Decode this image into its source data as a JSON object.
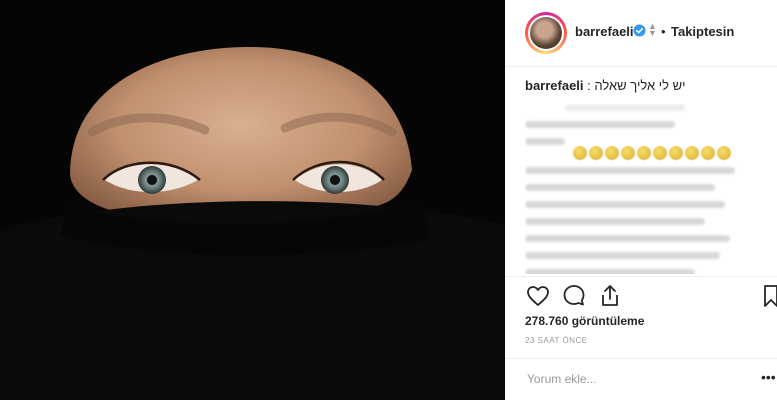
{
  "post": {
    "username": "barrefaeli",
    "follow_separator": "•",
    "follow_label": "Takiptesin",
    "caption_user": "barrefaeli",
    "caption_text": "יש לי אליך שאלה :",
    "views": "278.760 görüntüleme",
    "time_ago": "23 SAAT ÖNCE",
    "comment_placeholder": "Yorum ekle...",
    "more_label": "•••"
  },
  "icons": {
    "verified": "verified-badge-icon",
    "like": "heart-icon",
    "comment": "comment-icon",
    "share": "share-icon",
    "save": "bookmark-icon",
    "options": "more-options-icon"
  },
  "colors": {
    "verified_blue": "#3897f0",
    "text": "#262626",
    "muted": "#999999"
  }
}
